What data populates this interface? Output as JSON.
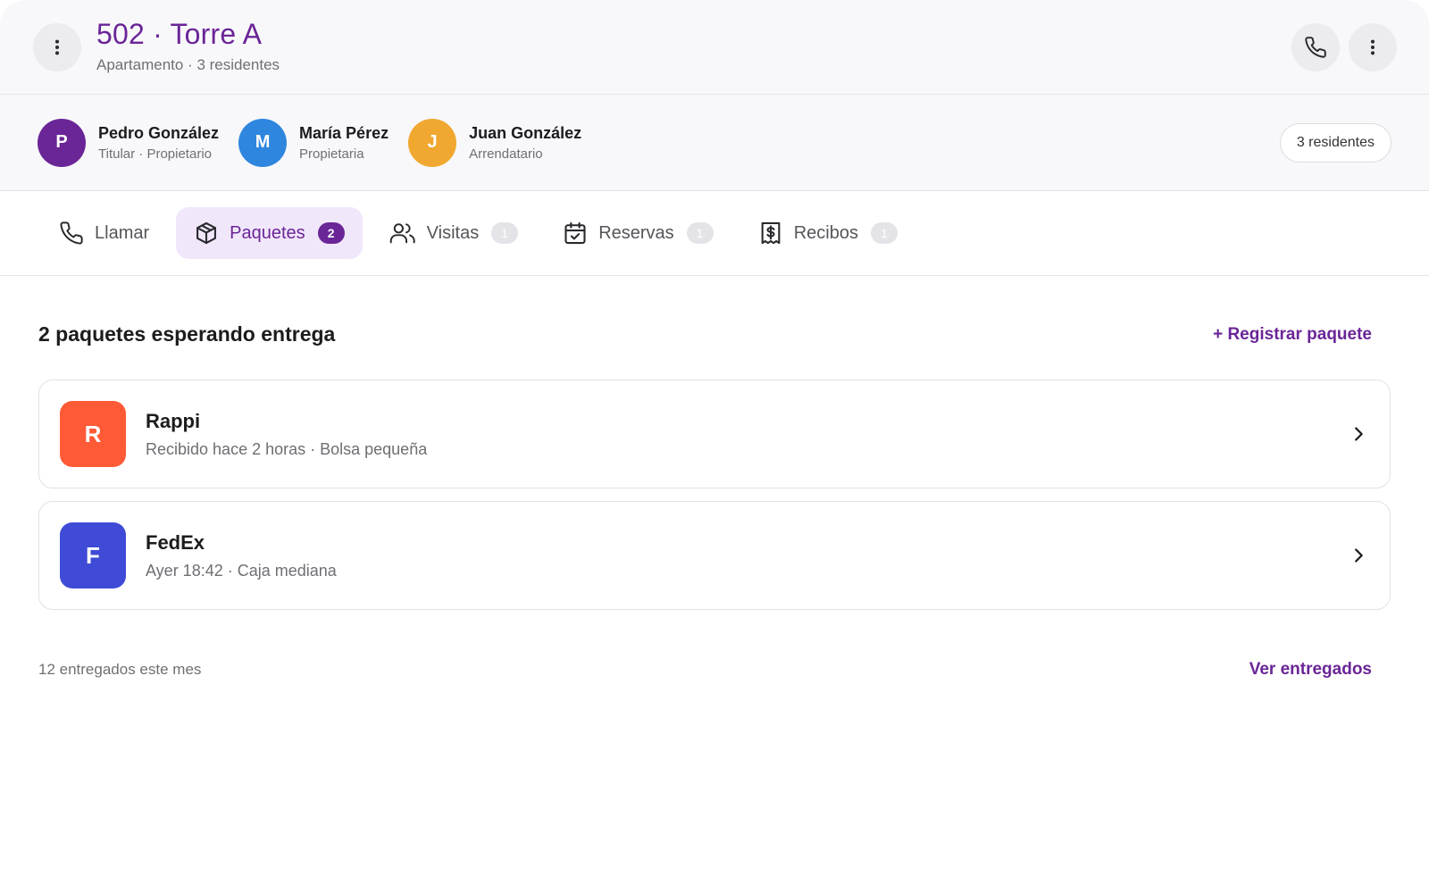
{
  "header": {
    "title": "502 · Torre A",
    "subtitle": "Apartamento · 3 residentes",
    "menu_icon": "more-vertical-icon",
    "call_icon": "phone-icon"
  },
  "residents": {
    "items": [
      {
        "initial": "P",
        "name": "Pedro González",
        "role": "Titular · Propietario",
        "color": "#6a2597"
      },
      {
        "initial": "M",
        "name": "María Pérez",
        "role": "Propietaria",
        "color": "#2e86de"
      },
      {
        "initial": "J",
        "name": "Juan González",
        "role": "Arrendatario",
        "color": "#f0a830"
      }
    ],
    "count_label": "3 residentes"
  },
  "tabs": [
    {
      "label": "Llamar",
      "icon": "phone-icon",
      "badge": ""
    },
    {
      "label": "Paquetes",
      "icon": "package-icon",
      "badge": "2",
      "active": true
    },
    {
      "label": "Visitas",
      "icon": "users-icon",
      "badge": "1"
    },
    {
      "label": "Reservas",
      "icon": "calendar-check-icon",
      "badge": "1"
    },
    {
      "label": "Recibos",
      "icon": "receipt-dollar-icon",
      "badge": "1"
    }
  ],
  "packages": {
    "heading": "2 paquetes esperando entrega",
    "register_label": "+ Registrar paquete",
    "items": [
      {
        "initial": "R",
        "carrier": "Rappi",
        "detail": "Recibido hace 2 horas · Bolsa pequeña",
        "color": "#ff5a36"
      },
      {
        "initial": "F",
        "carrier": "FedEx",
        "detail": "Ayer 18:42 · Caja mediana",
        "color": "#3f4bd6"
      }
    ],
    "delivered_note": "12 entregados este mes",
    "view_delivered_label": "Ver entregados"
  },
  "colors": {
    "accent": "#6a2597",
    "active_tab_bg": "#f1e7fb"
  }
}
